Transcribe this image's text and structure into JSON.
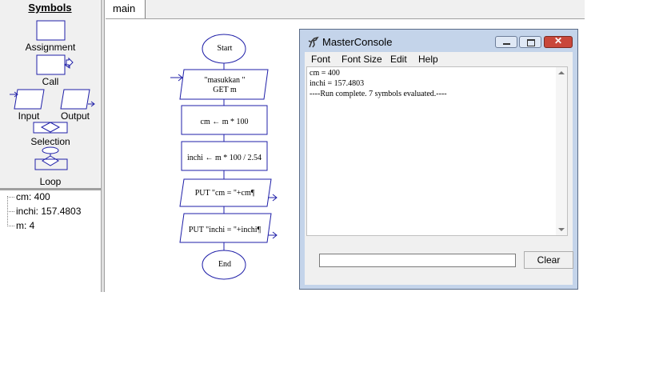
{
  "symbols": {
    "title": "Symbols",
    "assignment": "Assignment",
    "call": "Call",
    "input": "Input",
    "output": "Output",
    "selection": "Selection",
    "loop": "Loop"
  },
  "variables": [
    {
      "text": "cm: 400"
    },
    {
      "text": "inchi: 157.4803"
    },
    {
      "text": "m: 4"
    }
  ],
  "tabs": {
    "main": "main"
  },
  "flowchart": {
    "start": "Start",
    "input_prompt": "\"masukkan \"",
    "input_get": "GET m",
    "assign_cm": "cm ← m * 100",
    "assign_inchi": "inchi ← m * 100 / 2.54",
    "put_cm": "PUT \"cm = \"+cm¶",
    "put_inchi": "PUT \"inchi = \"+inchi¶",
    "end": "End"
  },
  "console": {
    "title": "MasterConsole",
    "menu": [
      "Font",
      "Font Size",
      "Edit",
      "Help"
    ],
    "lines": [
      "cm = 400",
      "inchi = 157.4803",
      "----Run complete.  7 symbols evaluated.----"
    ],
    "input_value": "",
    "clear_label": "Clear"
  },
  "colors": {
    "flowchart_stroke": "#1f1fa8",
    "titlebar": "#c4d4ea",
    "close_button": "#c9473a"
  }
}
